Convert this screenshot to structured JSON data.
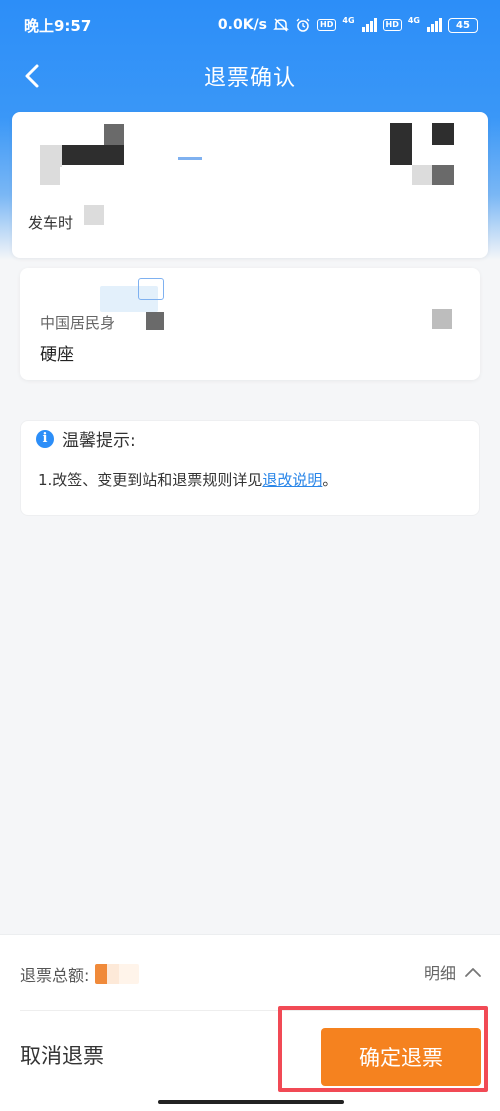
{
  "status_bar": {
    "time": "晚上9:57",
    "net_speed": "0.0K/s",
    "hd1": "HD",
    "net1": "4G",
    "hd2": "HD",
    "net2": "4G",
    "battery": "45"
  },
  "nav": {
    "title": "退票确认",
    "back_icon": "chevron-left-icon"
  },
  "train": {
    "departure_label": "发车时"
  },
  "passenger": {
    "id_type": "中国居民身",
    "seat_type": "硬座"
  },
  "tips": {
    "title": "温馨提示:",
    "line_prefix": "1.改签、变更到站和退票规则详见",
    "link_text": "退改说明",
    "line_suffix": "。"
  },
  "footer": {
    "total_label": "退票总额:",
    "detail_label": "明细",
    "cancel_label": "取消退票",
    "confirm_label": "确定退票"
  },
  "colors": {
    "primary": "#2c8ef8",
    "confirm": "#f5821f",
    "highlight": "#f14a55",
    "link": "#2a86e8"
  }
}
